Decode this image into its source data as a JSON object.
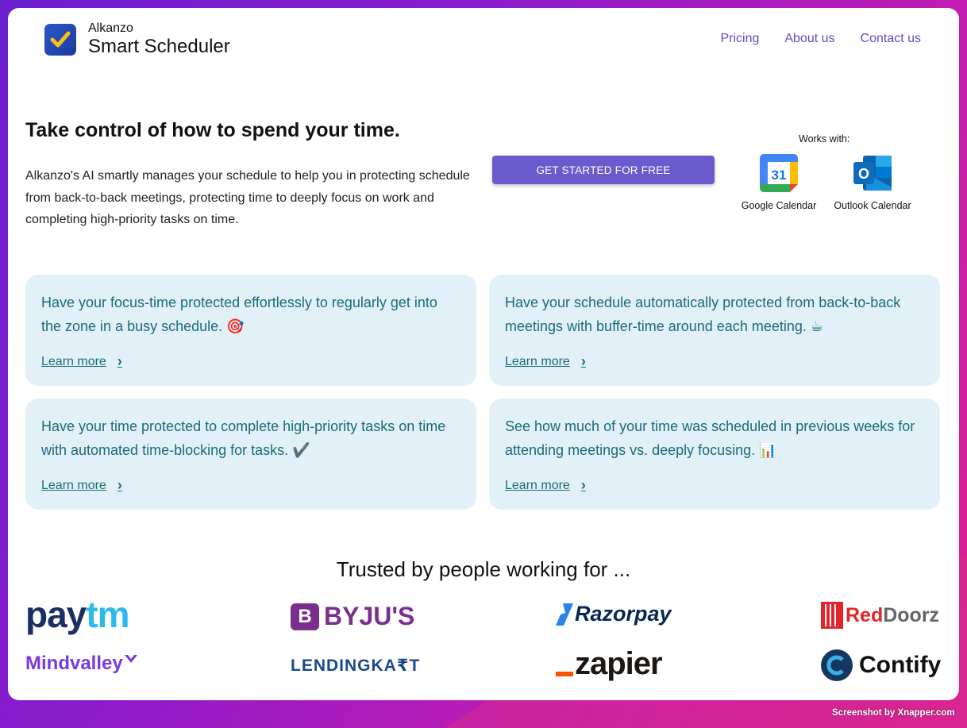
{
  "brand": {
    "company": "Alkanzo",
    "product": "Smart Scheduler",
    "logo_icon": "checkmark-icon"
  },
  "nav": {
    "items": [
      "Pricing",
      "About us",
      "Contact us"
    ]
  },
  "hero": {
    "title": "Take control of how to spend your time.",
    "description": "Alkanzo's AI smartly manages your schedule to help you in protecting schedule from back-to-back meetings, protecting time to deeply focus on work and completing high-priority tasks on time.",
    "cta_label": "GET STARTED FOR FREE"
  },
  "integrations": {
    "label": "Works with:",
    "items": [
      {
        "name": "Google Calendar",
        "icon": "google-calendar-icon",
        "day": "31"
      },
      {
        "name": "Outlook Calendar",
        "icon": "outlook-icon",
        "letter": "O"
      }
    ]
  },
  "features": [
    {
      "text": "Have your focus-time protected effortlessly to regularly get into the zone in a busy schedule. 🎯",
      "link": "Learn more"
    },
    {
      "text": "Have your schedule automatically protected from back-to-back meetings with buffer-time around each meeting. ☕",
      "link": "Learn more"
    },
    {
      "text": "Have your time protected to complete high-priority tasks on time with automated time-blocking for tasks. ✔️",
      "link": "Learn more"
    },
    {
      "text": "See how much of your time was scheduled in previous weeks for attending meetings vs. deeply focusing. 📊",
      "link": "Learn more"
    }
  ],
  "trusted": {
    "heading": "Trusted by people working for ...",
    "logos": {
      "paytm_a": "pay",
      "paytm_b": "tm",
      "byjus": "BYJU'S",
      "byjus_mark": "B",
      "razorpay": "Razorpay",
      "reddoorz_a": "Red",
      "reddoorz_b": "Doorz",
      "mindvalley": "Mindvalley",
      "lendingkart": "LENDINGKA₹T",
      "zapier": "zapier",
      "contify": "Contify"
    }
  },
  "footer": {
    "credit": "Screenshot by Xnapper.com"
  },
  "colors": {
    "accent": "#6a5acd",
    "nav": "#5b4fc7",
    "feature_bg": "#e2f1f7",
    "feature_text": "#1b6a7e"
  }
}
